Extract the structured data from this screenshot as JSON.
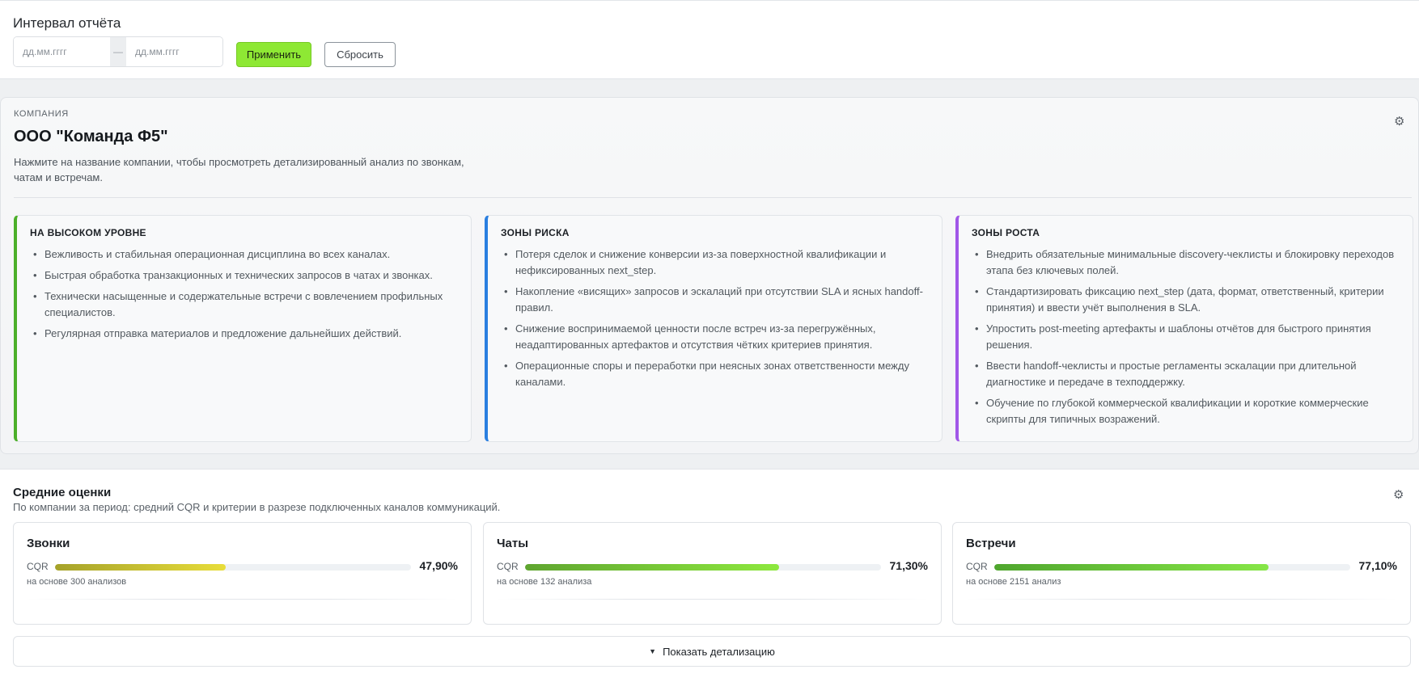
{
  "report_interval": {
    "title": "Интервал отчёта",
    "date_from_placeholder": "дд.мм.гггг",
    "separator": "—",
    "date_to_placeholder": "дд.мм.гггг",
    "apply_label": "Применить",
    "reset_label": "Сбросить"
  },
  "company": {
    "label": "КОМПАНИЯ",
    "name": "ООО \"Команда Ф5\"",
    "hint": "Нажмите на название компании, чтобы просмотреть детализированный анализ по звонкам, чатам и встречам.",
    "settings_icon": "gear-icon",
    "cards": [
      {
        "title": "НА ВЫСОКОМ УРОВНЕ",
        "accent": "#4caf2a",
        "items": [
          "Вежливость и стабильная операционная дисциплина во всех каналах.",
          "Быстрая обработка транзакционных и технических запросов в чатах и звонках.",
          "Технически насыщенные и содержательные встречи с вовлечением профильных специалистов.",
          "Регулярная отправка материалов и предложение дальнейших действий."
        ]
      },
      {
        "title": "ЗОНЫ РИСКА",
        "accent": "#2a7fe0",
        "items": [
          "Потеря сделок и снижение конверсии из-за поверхностной квалификации и нефиксированных next_step.",
          "Накопление «висящих» запросов и эскалаций при отсутствии SLA и ясных handoff-правил.",
          "Снижение воспринимаемой ценности после встреч из-за перегружённых, неадаптированных артефактов и отсутствия чётких критериев принятия.",
          "Операционные споры и переработки при неясных зонах ответственности между каналами."
        ]
      },
      {
        "title": "ЗОНЫ РОСТА",
        "accent": "#a157e8",
        "items": [
          "Внедрить обязательные минимальные discovery-чеклисты и блокировку переходов этапа без ключевых полей.",
          "Стандартизировать фиксацию next_step (дата, формат, ответственный, критерии принятия) и ввести учёт выполнения в SLA.",
          "Упростить post-meeting артефакты и шаблоны отчётов для быстрого принятия решения.",
          "Ввести handoff-чеклисты и простые регламенты эскалации при длительной диагностике и передаче в техподдержку.",
          "Обучение по глубокой коммерческой квалификации и короткие коммерческие скрипты для типичных возражений."
        ]
      }
    ]
  },
  "average_scores": {
    "title": "Средние оценки",
    "subtitle": "По компании за период: средний CQR и критерии в разрезе подключенных каналов коммуникаций.",
    "settings_icon": "gear-icon",
    "channels": [
      {
        "name": "Звонки",
        "metric": "CQR",
        "value_text": "47,90%",
        "value": 47.9,
        "basis": "на основе 300 анализов",
        "bar_colors": [
          "#a5a22a",
          "#e8dd3a"
        ]
      },
      {
        "name": "Чаты",
        "metric": "CQR",
        "value_text": "71,30%",
        "value": 71.3,
        "basis": "на основе 132 анализа",
        "bar_colors": [
          "#5fa530",
          "#8de83e"
        ]
      },
      {
        "name": "Встречи",
        "metric": "CQR",
        "value_text": "77,10%",
        "value": 77.1,
        "basis": "на основе 2151 анализ",
        "bar_colors": [
          "#4fa62e",
          "#86e647"
        ]
      }
    ],
    "details_button_label": "Показать детализацию",
    "details_icon": "caret-down-icon"
  }
}
